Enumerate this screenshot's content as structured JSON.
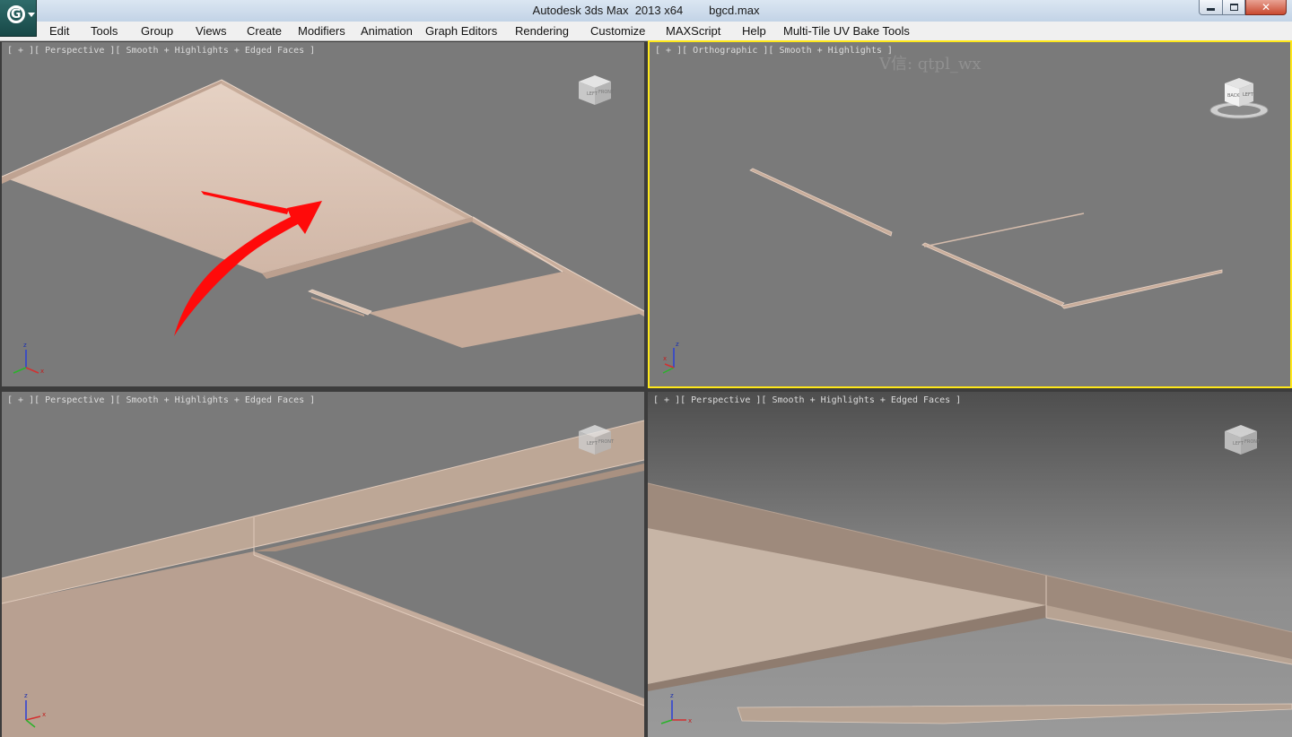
{
  "window": {
    "title": "Autodesk 3ds Max  2013 x64        bgcd.max",
    "buttons": {
      "minimize_icon": "minimize-icon",
      "maximize_icon": "restore-icon",
      "close_icon": "close-icon",
      "close_glyph": "✕"
    },
    "logo_glyph": "G"
  },
  "menu": [
    "Edit",
    "Tools",
    "Group",
    "Views",
    "Create",
    "Modifiers",
    "Animation",
    "Graph Editors",
    "Rendering",
    "Customize",
    "MAXScript",
    "Help",
    "Multi-Tile UV Bake Tools"
  ],
  "viewports": {
    "top_left": {
      "label": "[ + ][ Perspective ][ Smooth + Highlights + Edged Faces ]",
      "active": false,
      "viewcube": [
        "LEFT",
        "FRONT"
      ]
    },
    "top_right": {
      "label": "[ + ][ Orthographic ][ Smooth + Highlights ]",
      "active": true,
      "viewcube": [
        "BACK",
        "LEFT"
      ]
    },
    "bottom_left": {
      "label": "[ + ][ Perspective ][ Smooth + Highlights + Edged Faces ]",
      "active": false,
      "viewcube": [
        "LEFT",
        "FRONT"
      ]
    },
    "bottom_right": {
      "label": "[ + ][ Perspective ][ Smooth + Highlights + Edged Faces ]",
      "active": false,
      "viewcube": [
        "LEFT",
        "FRONT"
      ]
    }
  },
  "gizmo_axes": {
    "z": "z",
    "x": "x",
    "y": "y"
  },
  "watermark": "V信: qtpl_wx",
  "colors": {
    "viewport_bg": "#7a7a7a",
    "active_border": "#ffe81a",
    "object_fill": "#c9ae9e",
    "object_edge": "#e8d2c2",
    "annotation_arrow": "#ff0000"
  }
}
